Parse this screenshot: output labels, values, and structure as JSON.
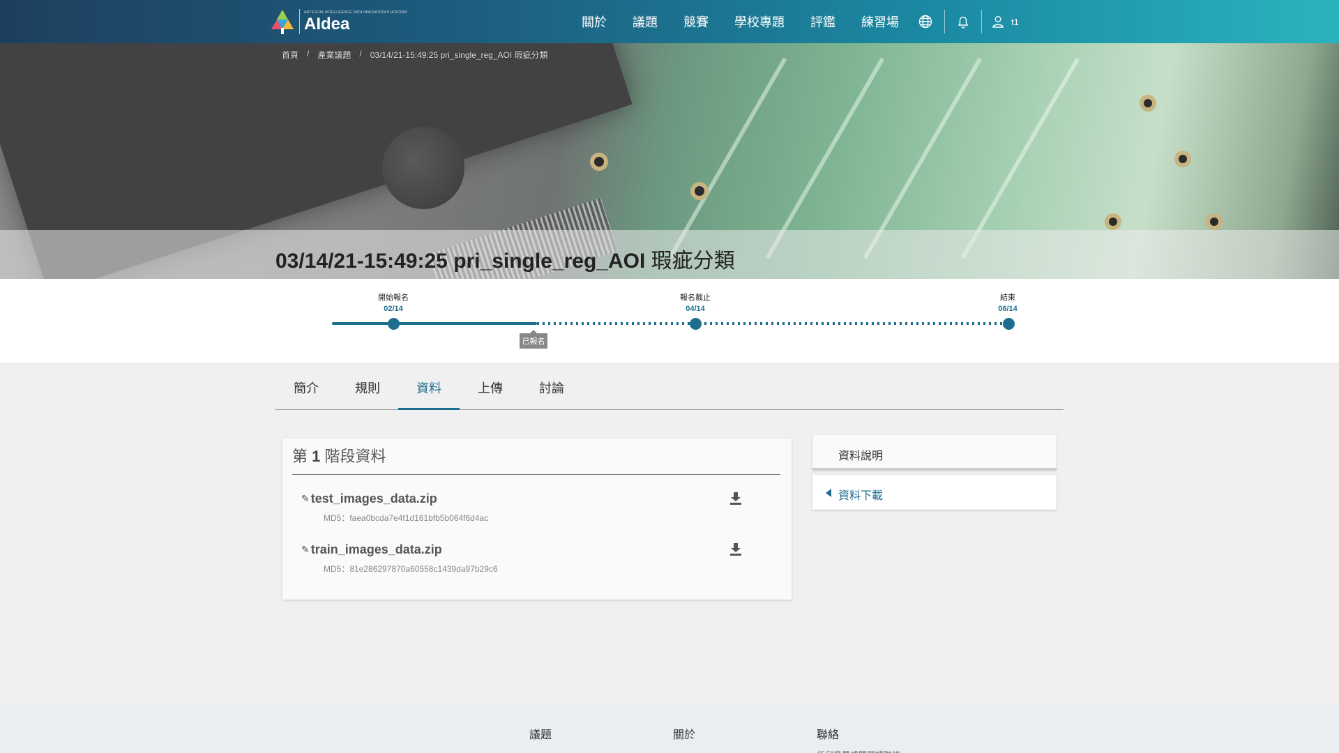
{
  "header": {
    "logo_small": "ARTIFICIAL INTELLIGENCE DATA INNOVATION PLATFORM",
    "logo_text": "AIdea",
    "nav": [
      "關於",
      "議題",
      "競賽",
      "學校專題",
      "評鑑",
      "練習場"
    ],
    "user_name": "t1"
  },
  "breadcrumb": [
    "首頁",
    "/",
    "產業議題",
    "/",
    "03/14/21-15:49:25 pri_single_reg_AOI 瑕疵分類"
  ],
  "title": {
    "bold": "03/14/21-15:49:25 pri_single_reg_AOI",
    "normal": " 瑕疵分類"
  },
  "timeline": {
    "start": {
      "label": "開始報名",
      "date": "02/14"
    },
    "deadline": {
      "label": "報名截止",
      "date": "04/14"
    },
    "end": {
      "label": "結束",
      "date": "06/14"
    },
    "status_badge": "已報名",
    "progress_fraction": 0.34
  },
  "tabs": [
    {
      "label": "簡介",
      "active": false
    },
    {
      "label": "規則",
      "active": false
    },
    {
      "label": "資料",
      "active": true
    },
    {
      "label": "上傳",
      "active": false
    },
    {
      "label": "討論",
      "active": false
    }
  ],
  "stage": {
    "prefix": "第 ",
    "number": "1",
    "suffix": " 階段資料"
  },
  "files": [
    {
      "name": "test_images_data.zip",
      "md5": "MD5：faea0bcda7e4f1d161bfb5b064f6d4ac"
    },
    {
      "name": "train_images_data.zip",
      "md5": "MD5：81e286297870a60558c1439da97b29c6"
    }
  ],
  "sidebar": {
    "description": "資料說明",
    "download": "資料下載"
  },
  "footer": {
    "cols": [
      "議題",
      "關於",
      "聯絡"
    ],
    "sub": "任何意見或問題請聯絡"
  },
  "colors": {
    "accent": "#1d6d8f",
    "navbar_start": "#1e3f5f",
    "navbar_end": "#2bb3bd"
  }
}
